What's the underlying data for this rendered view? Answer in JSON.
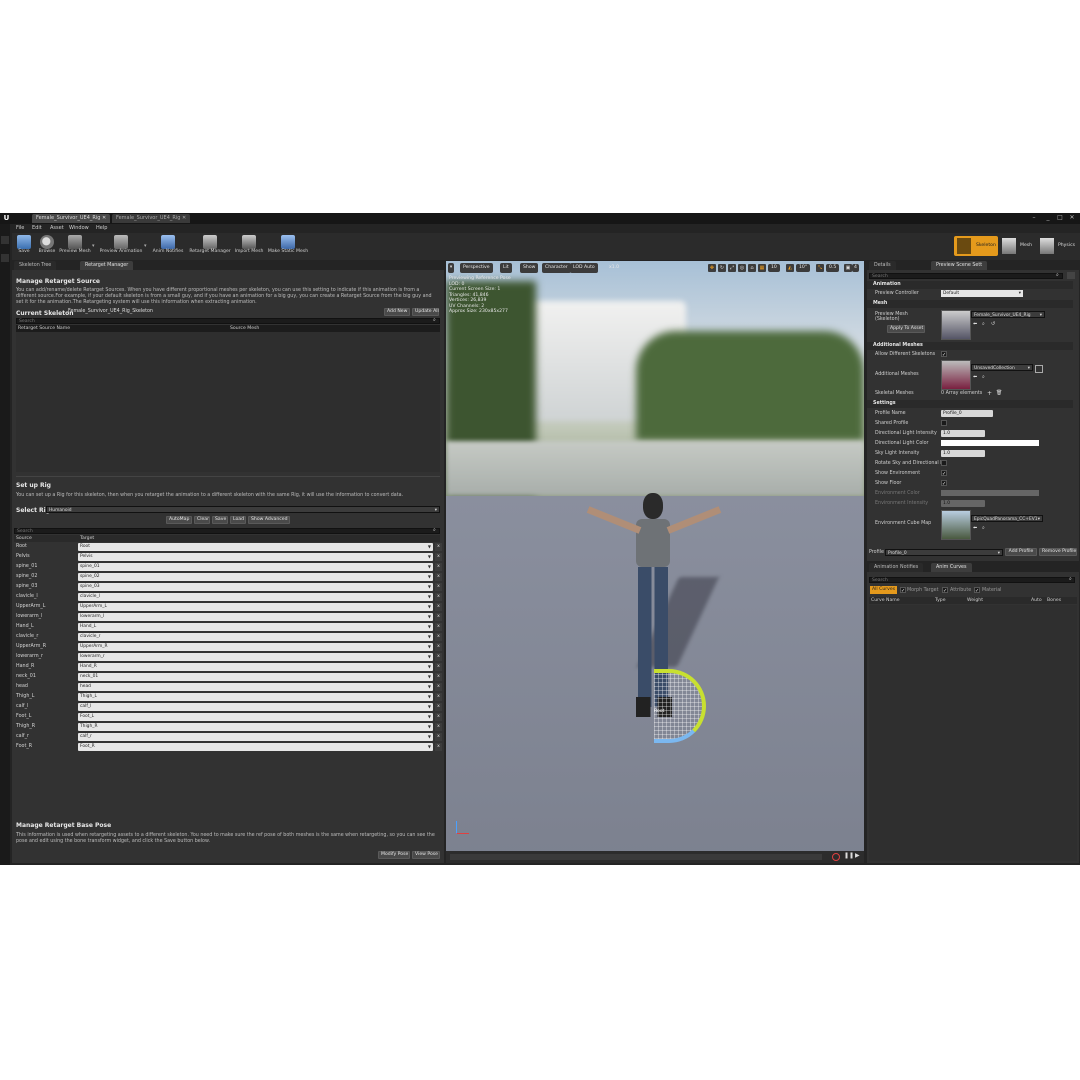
{
  "window": {
    "tabs": [
      "Female_Survivor_UE4_Rig",
      "Female_Survivor_UE4_Rig"
    ]
  },
  "menu": [
    "File",
    "Edit",
    "Asset",
    "Window",
    "Help"
  ],
  "toolbar": {
    "items": [
      "Save",
      "Browse",
      "Preview Mesh",
      "Preview Animation",
      "Anim Notifies",
      "Retarget Manager",
      "Import Mesh",
      "Make Static Mesh"
    ],
    "modes": [
      "Skeleton",
      "Mesh",
      "Physics"
    ]
  },
  "left_panel": {
    "tabs": [
      "Skeleton Tree",
      "Retarget Manager"
    ],
    "manage_source": {
      "title": "Manage Retarget Source",
      "description": "You can add/rename/delete Retarget Sources. When you have different proportional meshes per skeleton, you can use this setting to indicate if this animation is from a different source.For example, if your default skeleton is from a small guy, and if you have an animation for a big guy, you can create a Retarget Source from the big guy and set it for the animation.The Retargeting system will use this information when extracting animation.",
      "current_skeleton_label": "Current Skeleton",
      "current_skeleton_value": "Female_Survivor_UE4_Rig_Skeleton",
      "add_new": "Add New",
      "update_all": "Update All",
      "search_placeholder": "Search",
      "col_source_name": "Retarget Source Name",
      "col_source_mesh": "Source Mesh"
    },
    "setup_rig": {
      "title": "Set up Rig",
      "description": "You can set up a Rig for this skeleton, then when you retarget the animation to a different skeleton with the same Rig, it will use the information to convert data.",
      "select_rig_label": "Select Rig",
      "select_rig_value": "Humanoid",
      "buttons": [
        "AutoMap",
        "Clear",
        "Save",
        "Load",
        "Show Advanced"
      ],
      "search_placeholder": "Search",
      "col_source": "Source",
      "col_target": "Target",
      "rows": [
        {
          "source": "Root",
          "target": "Root"
        },
        {
          "source": "Pelvis",
          "target": "Pelvis"
        },
        {
          "source": "spine_01",
          "target": "spine_01"
        },
        {
          "source": "spine_02",
          "target": "spine_02"
        },
        {
          "source": "spine_03",
          "target": "spine_03"
        },
        {
          "source": "clavicle_l",
          "target": "clavicle_l"
        },
        {
          "source": "UpperArm_L",
          "target": "UpperArm_L"
        },
        {
          "source": "lowerarm_l",
          "target": "lowerarm_l"
        },
        {
          "source": "Hand_L",
          "target": "Hand_L"
        },
        {
          "source": "clavicle_r",
          "target": "clavicle_r"
        },
        {
          "source": "UpperArm_R",
          "target": "UpperArm_R"
        },
        {
          "source": "lowerarm_r",
          "target": "lowerarm_r"
        },
        {
          "source": "Hand_R",
          "target": "Hand_R"
        },
        {
          "source": "neck_01",
          "target": "neck_01"
        },
        {
          "source": "head",
          "target": "head"
        },
        {
          "source": "Thigh_L",
          "target": "Thigh_L"
        },
        {
          "source": "calf_l",
          "target": "calf_l"
        },
        {
          "source": "Foot_L",
          "target": "Foot_L"
        },
        {
          "source": "Thigh_R",
          "target": "Thigh_R"
        },
        {
          "source": "calf_r",
          "target": "calf_r"
        },
        {
          "source": "Foot_R",
          "target": "Foot_R"
        }
      ]
    },
    "base_pose": {
      "title": "Manage Retarget Base Pose",
      "description": "This information is used when retargeting assets to a different skeleton. You need to make sure the ref pose of both meshes is the same when retargeting, so you can see the pose and edit using the bone transform widget, and click the Save button below.",
      "modify_pose": "Modify Pose",
      "view_pose": "View Pose"
    }
  },
  "viewport": {
    "toolbar": [
      "Perspective",
      "Lit",
      "Show",
      "Character",
      "LOD Auto",
      "x1.0"
    ],
    "snap_values": [
      "10",
      "10°",
      "0.5",
      "4"
    ],
    "info": [
      "Previewing Reference Pose",
      "LOD: 0",
      "Current Screen Size: 1",
      "Triangles: 41,846",
      "Vertices: 26,839",
      "UV Channels: 2",
      "Approx Size: 230x85x277"
    ],
    "bone_label": "Root"
  },
  "details": {
    "tabs": [
      "Details",
      "Preview Scene Sett"
    ],
    "search_placeholder": "Search",
    "animation_section": "Animation",
    "preview_controller_label": "Preview Controller",
    "preview_controller_value": "Default",
    "mesh_section": "Mesh",
    "preview_mesh_label": "Preview Mesh",
    "preview_mesh_sub": "(Skeleton)",
    "preview_mesh_value": "Female_Survivor_UE4_Rig",
    "apply_to_asset": "Apply To Asset",
    "additional_meshes_section": "Additional Meshes",
    "allow_diff_skeletons": "Allow Different Skeletons",
    "additional_meshes_label": "Additional Meshes",
    "additional_meshes_value": "UnsavedCollection",
    "skeletal_meshes_label": "Skeletal Meshes",
    "skeletal_meshes_value": "0 Array elements",
    "settings_section": "Settings",
    "profile_name_label": "Profile Name",
    "profile_name_value": "Profile_0",
    "shared_profile": "Shared Profile",
    "dir_light_intensity_label": "Directional Light Intensity",
    "dir_light_intensity_value": "1.0",
    "dir_light_color_label": "Directional Light Color",
    "sky_light_label": "Sky Light Intensity",
    "sky_light_value": "1.0",
    "rotate_sky_label": "Rotate Sky and Directional Lig",
    "show_env_label": "Show Environment",
    "show_floor_label": "Show Floor",
    "env_color_label": "Environment Color",
    "env_intensity_label": "Environment Intensity",
    "env_intensity_value": "1.0",
    "env_cubemap_label": "Environment Cube Map",
    "env_cubemap_value": "EpicQuadPanorama_CC+EV1",
    "profile_label": "Profile",
    "profile_value": "Profile_0",
    "add_profile": "Add Profile",
    "remove_profile": "Remove Profile"
  },
  "curves": {
    "tabs": [
      "Animation Notifies",
      "Anim Curves"
    ],
    "search_placeholder": "Search",
    "filters": [
      "All Curves",
      "Morph Target",
      "Attribute",
      "Material"
    ],
    "columns": [
      "Curve Name",
      "Type",
      "Weight",
      "Auto",
      "Bones"
    ]
  },
  "colors": {
    "accent": "#e59a1c",
    "panel": "#323232",
    "background": "#242424"
  }
}
